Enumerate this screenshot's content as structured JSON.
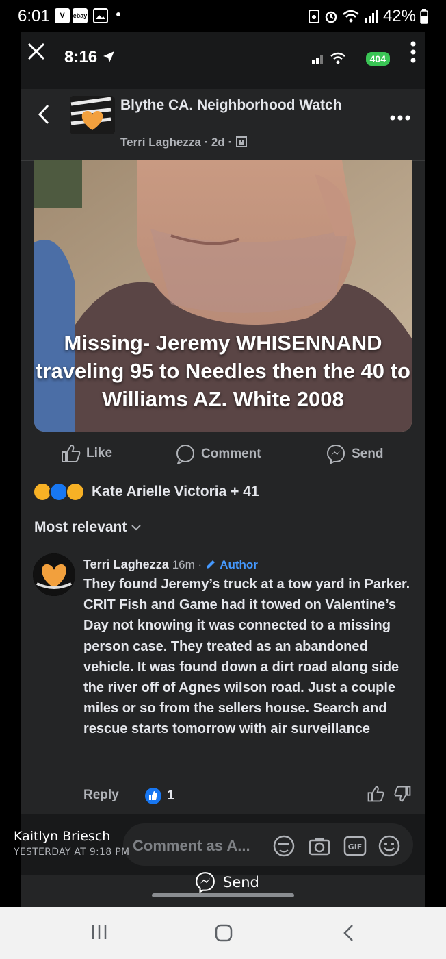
{
  "outer_status": {
    "time": "6:01",
    "icons": [
      "v-app-icon",
      "ebay-app-icon",
      "gallery-icon",
      "dot-icon"
    ],
    "ebay_label": "ebay",
    "right_icons": [
      "sim-icon",
      "alarm-icon",
      "wifi-icon",
      "signal-icon"
    ],
    "battery": "42%"
  },
  "inner_status": {
    "time": "8:16",
    "network": "404"
  },
  "post": {
    "group_name": "Blythe CA. Neighborhood Watch",
    "meta": "Terri Laghezza · 2d ·",
    "photo_caption": "Missing- Jeremy WHISENNAND traveling 95 to Needles then the 40 to Williams AZ. White 2008"
  },
  "actions": {
    "like": "Like",
    "comment": "Comment",
    "send": "Send"
  },
  "reactions": {
    "summary": "Kate Arielle Victoria + 41",
    "colors": [
      "#f7b125",
      "#1877f2",
      "#f7b125"
    ]
  },
  "sort": "Most relevant",
  "comment": {
    "author": "Terri Laghezza",
    "time": "16m ·",
    "author_badge": "Author",
    "text": "They found Jeremy’s truck at a tow yard in Parker.  CRIT Fish and Game had it towed on Valentine’s Day not knowing it was connected to a missing person case.  They treated as an abandoned vehicle.  It was found down a dirt road along side the river off of Agnes wilson road.  Just a couple miles or so from the sellers house.  Search and rescue starts tomorrow with air surveillance",
    "reply": "Reply",
    "like_count": "1"
  },
  "composer": {
    "placeholder": "Comment as A..."
  },
  "overlay": {
    "name": "Kaitlyn Briesch",
    "timestamp": "YESTERDAY AT 9:18 PM",
    "send_label": "Send"
  },
  "colors": {
    "accent": "#1877f2",
    "author_blue": "#4599ff",
    "battery_green": "#3ac555",
    "bg": "#242526"
  }
}
